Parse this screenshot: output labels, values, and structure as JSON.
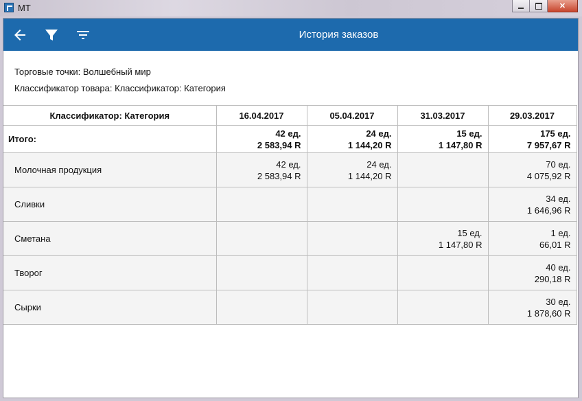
{
  "window": {
    "title": "МТ"
  },
  "appbar": {
    "title": "История заказов",
    "back_icon": "arrow-left-icon",
    "filter_icon": "filter-icon",
    "sort_icon": "sort-icon"
  },
  "info": {
    "trade_points": "Торговые точки: Волшебный мир",
    "classifier": "Классификатор товара: Классификатор: Категория"
  },
  "table": {
    "header": {
      "category": "Классификатор: Категория",
      "dates": [
        "16.04.2017",
        "05.04.2017",
        "31.03.2017",
        "29.03.2017"
      ]
    },
    "total": {
      "label": "Итого:",
      "cells": [
        {
          "qty": "42 ед.",
          "sum": "2 583,94 R"
        },
        {
          "qty": "24 ед.",
          "sum": "1 144,20 R"
        },
        {
          "qty": "15 ед.",
          "sum": "1 147,80 R"
        },
        {
          "qty": "175 ед.",
          "sum": "7 957,67 R"
        }
      ]
    },
    "rows": [
      {
        "label": "Молочная продукция",
        "cells": [
          {
            "qty": "42 ед.",
            "sum": "2 583,94 R"
          },
          {
            "qty": "24 ед.",
            "sum": "1 144,20 R"
          },
          {
            "qty": "",
            "sum": ""
          },
          {
            "qty": "70 ед.",
            "sum": "4 075,92 R"
          }
        ]
      },
      {
        "label": "Сливки",
        "cells": [
          {
            "qty": "",
            "sum": ""
          },
          {
            "qty": "",
            "sum": ""
          },
          {
            "qty": "",
            "sum": ""
          },
          {
            "qty": "34 ед.",
            "sum": "1 646,96 R"
          }
        ]
      },
      {
        "label": "Сметана",
        "cells": [
          {
            "qty": "",
            "sum": ""
          },
          {
            "qty": "",
            "sum": ""
          },
          {
            "qty": "15 ед.",
            "sum": "1 147,80 R"
          },
          {
            "qty": "1 ед.",
            "sum": "66,01 R"
          }
        ]
      },
      {
        "label": "Творог",
        "cells": [
          {
            "qty": "",
            "sum": ""
          },
          {
            "qty": "",
            "sum": ""
          },
          {
            "qty": "",
            "sum": ""
          },
          {
            "qty": "40 ед.",
            "sum": "290,18 R"
          }
        ]
      },
      {
        "label": "Сырки",
        "cells": [
          {
            "qty": "",
            "sum": ""
          },
          {
            "qty": "",
            "sum": ""
          },
          {
            "qty": "",
            "sum": ""
          },
          {
            "qty": "30 ед.",
            "sum": "1 878,60 R"
          }
        ]
      }
    ]
  },
  "colors": {
    "appbar": "#1d6aad",
    "row_bg": "#f4f4f4",
    "border": "#bdbdbd"
  }
}
